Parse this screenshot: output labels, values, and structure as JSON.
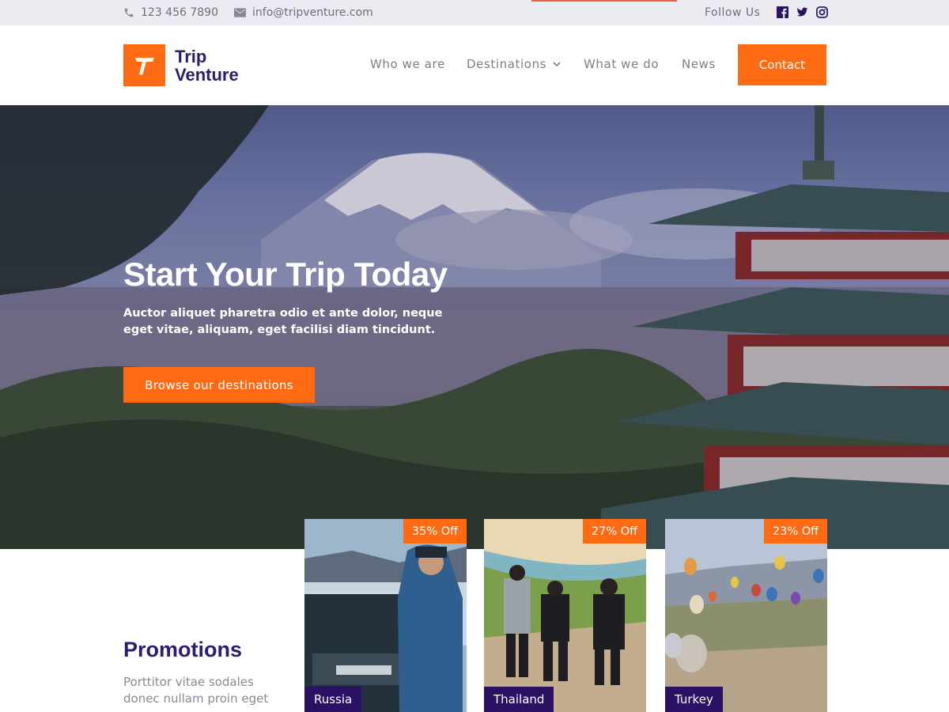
{
  "topbar": {
    "phone": "123 456 7890",
    "email": "info@tripventure.com",
    "follow_label": "Follow Us",
    "social_icons": [
      "facebook-icon",
      "twitter-icon",
      "instagram-icon"
    ]
  },
  "header": {
    "logo_line1": "Trip",
    "logo_line2": "Venture",
    "nav": [
      "Who we are",
      "Destinations",
      "What we do",
      "News"
    ],
    "contact_label": "Contact"
  },
  "hero": {
    "title": "Start Your Trip Today",
    "subtitle": "Auctor aliquet pharetra odio et ante dolor, neque eget vitae, aliquam, eget facilisi diam tincidunt.",
    "cta_label": "Browse our destinations"
  },
  "promotions": {
    "title": "Promotions",
    "text": "Porttitor vitae sodales donec nullam proin eget",
    "cards": [
      {
        "label": "Russia",
        "discount": "35% Off"
      },
      {
        "label": "Thailand",
        "discount": "27% Off"
      },
      {
        "label": "Turkey",
        "discount": "23% Off"
      }
    ]
  },
  "colors": {
    "accent": "#ff6a13",
    "brand_dark": "#2e1c6e",
    "label_bg": "#2a1164"
  }
}
